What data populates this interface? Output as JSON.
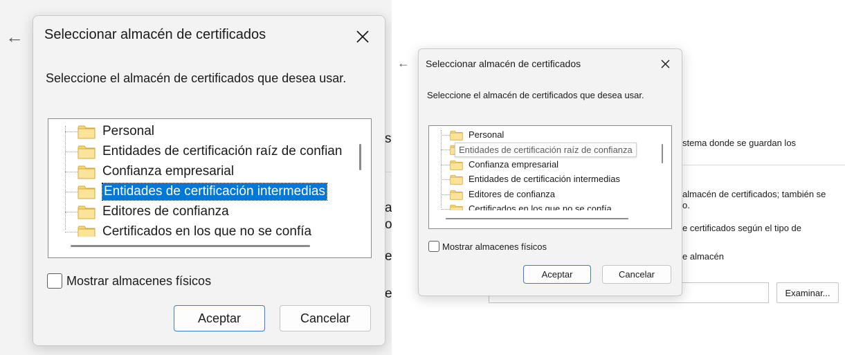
{
  "dialog": {
    "title": "Seleccionar almacén de certificados",
    "prompt": "Seleccione el almacén de certificados que desea usar.",
    "stores": [
      "Personal",
      "Entidades de certificación raíz de confianza",
      "Confianza empresarial",
      "Entidades de certificación intermedias",
      "Editores de confianza",
      "Certificados en los que no se confía"
    ],
    "left_visible_stores": [
      "Personal",
      "Entidades de certificación raíz de confian",
      "Confianza empresarial",
      "Entidades de certificación intermedias",
      "Editores de confianza",
      "Certificados en los que no se confía"
    ],
    "selected_store": "Entidades de certificación intermedias",
    "tooltip": "Entidades de certificación raíz de confianza",
    "physical_stores_label": "Mostrar almacenes físicos",
    "physical_stores_checked": false,
    "accept_label": "Aceptar",
    "cancel_label": "Cancelar"
  },
  "background": {
    "left_fragments": [
      "st",
      "al",
      "o.",
      "e",
      "e"
    ],
    "right_fragments": [
      "stema donde se guardan los",
      "almacén de certificados; también se",
      "o.",
      "e certificados según el tipo de",
      "e almacén"
    ],
    "browse_label": "Examinar..."
  },
  "colors": {
    "selection": "#0078d7",
    "primary_border": "#3a7bd5",
    "dialog_bg": "#f3f3f3"
  }
}
